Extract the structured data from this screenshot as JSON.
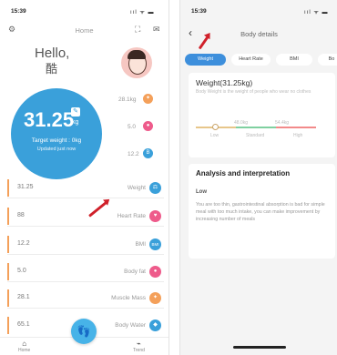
{
  "left": {
    "status_time": "15:39",
    "status_icons": "ııl ᯤ ▬",
    "title": "Home",
    "greeting": "Hello,",
    "user_name": "酷",
    "summary": {
      "weight": "31.25",
      "unit": "kg",
      "unit_icon": "✎",
      "target": "Target weight : 0kg",
      "updated": "Updated just now"
    },
    "side_metrics": [
      {
        "value": "28.1kg",
        "icon": "muscle-icon",
        "color": "#f4a05a"
      },
      {
        "value": "5.0",
        "icon": "fat-icon",
        "color": "#ee5b8b"
      },
      {
        "value": "12.2",
        "icon": "bmi-icon",
        "color": "#3aa0da"
      }
    ],
    "rows": [
      {
        "value": "31.25",
        "label": "Weight",
        "glyph": "⚖",
        "color": "#3aa0da"
      },
      {
        "value": "88",
        "label": "Heart Rate",
        "glyph": "♥",
        "color": "#ee5b8b"
      },
      {
        "value": "12.2",
        "label": "BMI",
        "glyph": "BMI",
        "color": "#3aa0da"
      },
      {
        "value": "5.0",
        "label": "Body fat",
        "glyph": "●",
        "color": "#ee5b8b"
      },
      {
        "value": "28.1",
        "label": "Muscle Mass",
        "glyph": "✦",
        "color": "#f4a05a"
      },
      {
        "value": "65.1",
        "label": "Body Water",
        "glyph": "◆",
        "color": "#3aa0da"
      }
    ],
    "nav": {
      "home": "Home",
      "trend": "Trend",
      "fab_glyph": "👣"
    }
  },
  "right": {
    "status_time": "15:39",
    "status_icons": "ııl ᯤ ▬",
    "title": "Body details",
    "tabs": [
      "Weight",
      "Heart Rate",
      "BMI",
      "Bo"
    ],
    "weight_card": {
      "title": "Weight(31.25kg)",
      "desc": "Body Weight is the weight of people who wear no clothes",
      "ticks": [
        "48.0kg",
        "54.4kg"
      ],
      "labels": [
        "Low",
        "Standard",
        "High"
      ]
    },
    "analysis": {
      "title": "Analysis and interpretation",
      "level": "Low",
      "text": "You are too thin, gastrointestinal absorption is bad for simple meal with too much intake, you can make improvement by increasing number of meals"
    }
  },
  "colors": {
    "accent": "#3aa0da",
    "tab_active": "#3d8fdc",
    "annotation": "#d0202a"
  }
}
